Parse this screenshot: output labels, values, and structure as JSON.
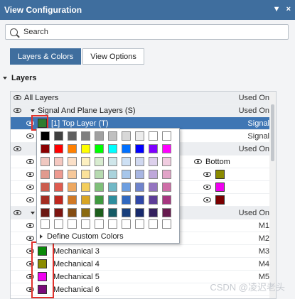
{
  "window": {
    "title": "View Configuration",
    "pin_glyph": "▼",
    "close_glyph": "×"
  },
  "search": {
    "placeholder": "Search"
  },
  "tabs": [
    {
      "label": "Layers & Colors"
    },
    {
      "label": "View Options"
    }
  ],
  "section": {
    "title": "Layers"
  },
  "rows": [
    {
      "label": "All Layers",
      "right": "Used On"
    },
    {
      "label": "Signal And Plane Layers (S)",
      "right": "Used On"
    },
    {
      "label": "[1] Top Layer (T)",
      "right": "Signal",
      "color": "#2f7d2f"
    },
    {
      "label": "",
      "right": "Signal"
    },
    {
      "label": "",
      "right": "Used On"
    },
    {
      "label": "Bottom",
      "right": ""
    },
    {
      "label": "",
      "right": "",
      "color": "#8b8b00"
    },
    {
      "label": "",
      "right": "",
      "color": "#f000f0"
    },
    {
      "label": "",
      "right": "",
      "color": "#7a0000"
    },
    {
      "label": "",
      "right": "Used On"
    },
    {
      "label": "",
      "right": "M1"
    },
    {
      "label": "",
      "right": "M2"
    },
    {
      "label": "Mechanical 3",
      "right": "M3",
      "color": "#0a8a0a"
    },
    {
      "label": "Mechanical 4",
      "right": "M4",
      "color": "#8b8b00"
    },
    {
      "label": "Mechanical 5",
      "right": "M5",
      "color": "#f000f0"
    },
    {
      "label": "Mechanical 6",
      "right": "",
      "color": "#7a0a7a"
    }
  ],
  "palette": {
    "define_label": "Define Custom Colors",
    "grid": [
      [
        "#000000",
        "#404040",
        "#606060",
        "#808080",
        "#a0a0a0",
        "#c0c0c0",
        "#d8d8d8",
        "#ececec",
        "#ffffff",
        "#ffffff"
      ],
      [
        "#8b0000",
        "#ff0000",
        "#ff8000",
        "#ffff00",
        "#00ff00",
        "#00ffff",
        "#0070ff",
        "#0000ff",
        "#8000ff",
        "#ff00ff"
      ],
      [
        "#f0c8c0",
        "#f5c8c0",
        "#fbe0c8",
        "#fdf0c0",
        "#d8ecd0",
        "#cfe6ea",
        "#cde0f4",
        "#d0d8f0",
        "#ddd0ec",
        "#f0cce0"
      ],
      [
        "#e19a8e",
        "#ee9a90",
        "#f6c89a",
        "#fbe29a",
        "#b6dab0",
        "#a9d3dc",
        "#a6c6ea",
        "#a8b6e2",
        "#bfa8da",
        "#e2a4c8"
      ],
      [
        "#cc5d4e",
        "#e05c50",
        "#eea860",
        "#f4ce5c",
        "#80c07a",
        "#70b8c6",
        "#6c9ee0",
        "#6f84cc",
        "#9575c0",
        "#cf6ea8"
      ],
      [
        "#a32e22",
        "#c0281f",
        "#d07824",
        "#d8a524",
        "#409a40",
        "#2e8e9e",
        "#3068c0",
        "#3048a8",
        "#5e3e98",
        "#a63680"
      ],
      [
        "#6b1812",
        "#7e1510",
        "#844c12",
        "#8a6a10",
        "#1c5e1c",
        "#145a64",
        "#183e7c",
        "#182a6c",
        "#34205e",
        "#661a4e"
      ],
      [
        "#ffffff",
        "#ffffff",
        "#ffffff",
        "#ffffff",
        "#ffffff",
        "#ffffff",
        "#ffffff",
        "#ffffff",
        "#ffffff",
        "#ffffff"
      ]
    ]
  },
  "watermark": "CSDN @凌迟老头"
}
